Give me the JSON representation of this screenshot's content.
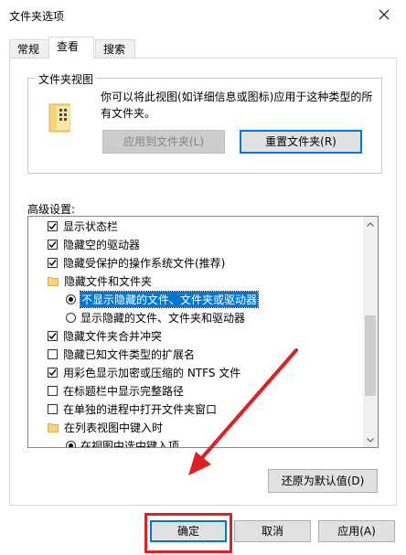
{
  "window": {
    "title": "文件夹选项",
    "close_icon": "close-icon"
  },
  "tabs": [
    {
      "label": "常规",
      "active": false
    },
    {
      "label": "查看",
      "active": true
    },
    {
      "label": "搜索",
      "active": false
    }
  ],
  "folder_views": {
    "group_label": "文件夹视图",
    "description": "你可以将此视图(如详细信息或图标)应用于这种类型的所有文件夹。",
    "apply_button": "应用到文件夹(L)",
    "reset_button": "重置文件夹(R)"
  },
  "advanced": {
    "label": "高级设置:",
    "items": [
      {
        "type": "checkbox",
        "checked": true,
        "label": "显示状态栏"
      },
      {
        "type": "checkbox",
        "checked": true,
        "label": "隐藏空的驱动器"
      },
      {
        "type": "checkbox",
        "checked": true,
        "label": "隐藏受保护的操作系统文件(推荐)"
      },
      {
        "type": "folder",
        "label": "隐藏文件和文件夹"
      },
      {
        "type": "radio",
        "checked": true,
        "label": "不显示隐藏的文件、文件夹或驱动器"
      },
      {
        "type": "radio",
        "checked": false,
        "label": "显示隐藏的文件、文件夹和驱动器"
      },
      {
        "type": "checkbox",
        "checked": true,
        "label": "隐藏文件夹合并冲突"
      },
      {
        "type": "checkbox",
        "checked": false,
        "label": "隐藏已知文件类型的扩展名"
      },
      {
        "type": "checkbox",
        "checked": true,
        "label": "用彩色显示加密或压缩的 NTFS 文件"
      },
      {
        "type": "checkbox",
        "checked": false,
        "label": "在标题栏中显示完整路径"
      },
      {
        "type": "checkbox",
        "checked": false,
        "label": "在单独的进程中打开文件夹窗口"
      },
      {
        "type": "folder",
        "label": "在列表视图中键入时"
      },
      {
        "type": "radio",
        "checked": true,
        "label": "在视图中选中键入项"
      }
    ]
  },
  "restore_button": "还原为默认值(D)",
  "buttons": {
    "ok": "确定",
    "cancel": "取消",
    "apply": "应用(A)"
  },
  "colors": {
    "highlight": "#e02020",
    "selection": "#0078d7"
  }
}
